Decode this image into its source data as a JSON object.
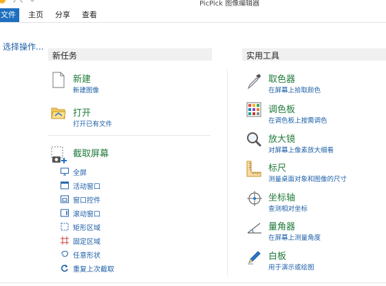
{
  "app": {
    "title": "PicPick 图像编辑器"
  },
  "ribbon": {
    "tabs": [
      {
        "label": "文件",
        "active": true
      },
      {
        "label": "主页",
        "active": false
      },
      {
        "label": "分享",
        "active": false
      },
      {
        "label": "查看",
        "active": false
      }
    ]
  },
  "left": {
    "link": "选择操作..."
  },
  "new_task": {
    "header": "新任务",
    "new": {
      "title": "新建",
      "sub": "新建图像"
    },
    "open": {
      "title": "打开",
      "sub": "打开已有文件"
    },
    "capture": {
      "title": "截取屏幕",
      "items": [
        {
          "label": "全屏",
          "icon": "monitor-icon"
        },
        {
          "label": "活动窗口",
          "icon": "window-icon"
        },
        {
          "label": "窗口控件",
          "icon": "window-control-icon"
        },
        {
          "label": "滚动窗口",
          "icon": "scroll-window-icon"
        },
        {
          "label": "矩形区域",
          "icon": "rectangle-region-icon"
        },
        {
          "label": "固定区域",
          "icon": "fixed-region-icon"
        },
        {
          "label": "任意形状",
          "icon": "freehand-icon"
        },
        {
          "label": "重复上次截取",
          "icon": "repeat-icon"
        }
      ]
    }
  },
  "tools": {
    "header": "实用工具",
    "items": [
      {
        "title": "取色器",
        "sub": "在屏幕上拾取颜色",
        "icon": "eyedropper-icon"
      },
      {
        "title": "调色板",
        "sub": "在调色板上按需调色",
        "icon": "palette-icon"
      },
      {
        "title": "放大镜",
        "sub": "对屏幕上像素放大细看",
        "icon": "magnifier-icon"
      },
      {
        "title": "标尺",
        "sub": "测量桌面对象和图像的尺寸",
        "icon": "ruler-icon"
      },
      {
        "title": "坐标轴",
        "sub": "查测相对坐标",
        "icon": "crosshair-icon"
      },
      {
        "title": "量角器",
        "sub": "在屏幕上测量角度",
        "icon": "protractor-icon"
      },
      {
        "title": "白板",
        "sub": "用于演示或绘图",
        "icon": "whiteboard-pen-icon"
      }
    ]
  },
  "colors": {
    "accent": "#1e6fc0",
    "title_green": "#1f7a3a",
    "link_blue": "#1e5fa8"
  }
}
